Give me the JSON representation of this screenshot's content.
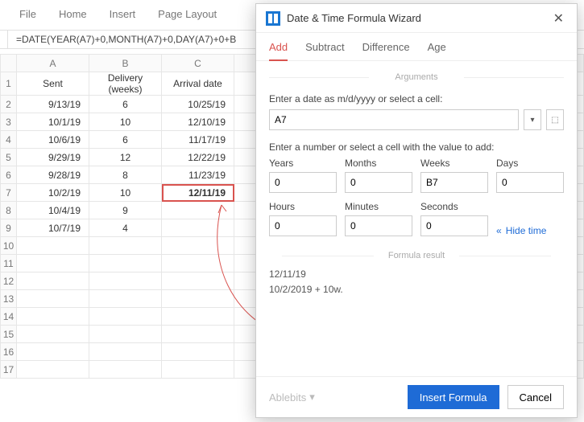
{
  "ribbon": {
    "file": "File",
    "home": "Home",
    "insert": "Insert",
    "page_layout": "Page Layout"
  },
  "formula_bar": "=DATE(YEAR(A7)+0,MONTH(A7)+0,DAY(A7)+0+B",
  "columns": {
    "A": "A",
    "B": "B",
    "C": "C"
  },
  "headers": {
    "sent": "Sent",
    "delivery": "Delivery (weeks)",
    "arrival": "Arrival date"
  },
  "rows": [
    {
      "n": "1"
    },
    {
      "n": "2",
      "sent": "9/13/19",
      "weeks": "6",
      "arrival": "10/25/19"
    },
    {
      "n": "3",
      "sent": "10/1/19",
      "weeks": "10",
      "arrival": "12/10/19"
    },
    {
      "n": "4",
      "sent": "10/6/19",
      "weeks": "6",
      "arrival": "11/17/19"
    },
    {
      "n": "5",
      "sent": "9/29/19",
      "weeks": "12",
      "arrival": "12/22/19"
    },
    {
      "n": "6",
      "sent": "9/28/19",
      "weeks": "8",
      "arrival": "11/23/19"
    },
    {
      "n": "7",
      "sent": "10/2/19",
      "weeks": "10",
      "arrival": "12/11/19"
    },
    {
      "n": "8",
      "sent": "10/4/19",
      "weeks": "9",
      "arrival": ""
    },
    {
      "n": "9",
      "sent": "10/7/19",
      "weeks": "4",
      "arrival": ""
    },
    {
      "n": "10"
    },
    {
      "n": "11"
    },
    {
      "n": "12"
    },
    {
      "n": "13"
    },
    {
      "n": "14"
    },
    {
      "n": "15"
    },
    {
      "n": "16"
    },
    {
      "n": "17"
    }
  ],
  "panel": {
    "title": "Date & Time Formula Wizard",
    "tabs": {
      "add": "Add",
      "subtract": "Subtract",
      "difference": "Difference",
      "age": "Age"
    },
    "section_args": "Arguments",
    "date_label": "Enter a date as m/d/yyyy or select a cell:",
    "date_value": "A7",
    "value_label": "Enter a number or select a cell with the value to add:",
    "fields": {
      "years_l": "Years",
      "years_v": "0",
      "months_l": "Months",
      "months_v": "0",
      "weeks_l": "Weeks",
      "weeks_v": "B7",
      "days_l": "Days",
      "days_v": "0",
      "hours_l": "Hours",
      "hours_v": "0",
      "minutes_l": "Minutes",
      "minutes_v": "0",
      "seconds_l": "Seconds",
      "seconds_v": "0"
    },
    "hide_time": "Hide time",
    "section_result": "Formula result",
    "result_date": "12/11/19",
    "result_expr": "10/2/2019 + 10w.",
    "brand": "Ablebits",
    "insert_btn": "Insert Formula",
    "cancel_btn": "Cancel"
  }
}
